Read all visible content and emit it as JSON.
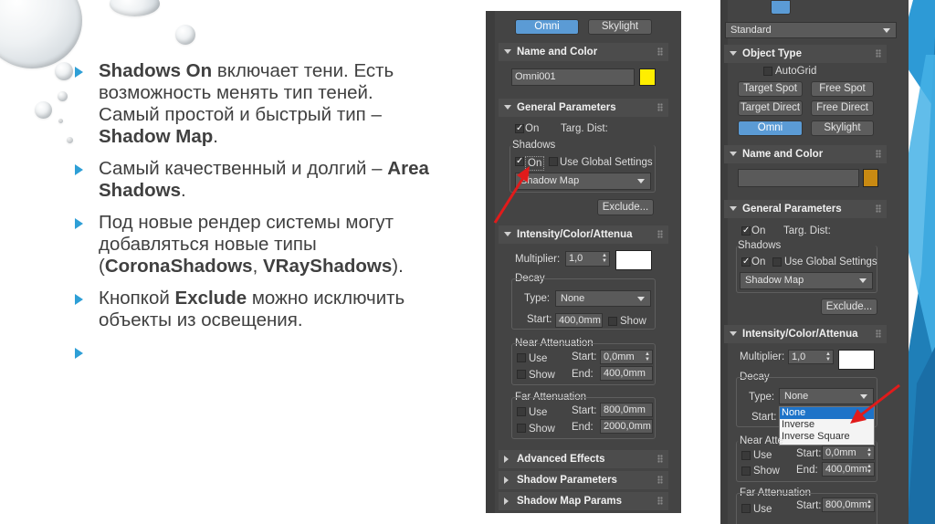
{
  "slide": {
    "bullets": [
      {
        "b": "Shadows On",
        "t": " включает тени. Есть возможность менять тип теней. Самый простой и быстрый тип – ",
        "b2": "Shadow Map",
        "t2": "."
      },
      {
        "t": "Самый качественный и долгий – ",
        "b": "Area Shadows",
        "t2": "."
      },
      {
        "t": "Под новые рендер системы могут добавляться новые типы (",
        "b": "CoronaShadows",
        "t2": ", ",
        "b2": "VRayShadows",
        "t3": ")."
      },
      {
        "t": "Кнопкой ",
        "b": "Exclude",
        "t2": " можно исключить объекты из освещения."
      }
    ]
  },
  "left_panel": {
    "top_buttons": [
      "Omni",
      "Skylight"
    ],
    "rollouts": {
      "name_color": "Name and Color",
      "general": "General Parameters",
      "intensity": "Intensity/Color/Attenua",
      "advanced": "Advanced Effects",
      "shadow_params": "Shadow Parameters",
      "shadow_map_params": "Shadow Map Params"
    },
    "object_name": "Omni001",
    "swatch_color": "#ffee00",
    "general": {
      "on": "On",
      "targ_dist": "Targ. Dist:",
      "shadows": "Shadows",
      "shadows_on": "On",
      "use_global": "Use Global Settings",
      "shadow_type": "Shadow Map",
      "exclude": "Exclude..."
    },
    "intensity": {
      "multiplier_label": "Multiplier:",
      "multiplier": "1,0",
      "decay": "Decay",
      "type_label": "Type:",
      "type": "None",
      "start_label": "Start:",
      "start": "400,0mm",
      "show": "Show"
    },
    "near": {
      "title": "Near Attenuation",
      "use": "Use",
      "show": "Show",
      "start_label": "Start:",
      "start": "0,0mm",
      "end_label": "End:",
      "end": "400,0mm"
    },
    "far": {
      "title": "Far Attenuation",
      "use": "Use",
      "show": "Show",
      "start_label": "Start:",
      "start": "800,0mm",
      "end_label": "End:",
      "end": "2000,0mm"
    }
  },
  "right_panel": {
    "category": "Standard",
    "rollouts": {
      "object_type": "Object Type",
      "name_color": "Name and Color",
      "general": "General Parameters",
      "intensity": "Intensity/Color/Attenua"
    },
    "autogrid": "AutoGrid",
    "object_buttons": [
      "Target Spot",
      "Free Spot",
      "Target Direct",
      "Free Direct",
      "Omni",
      "Skylight"
    ],
    "swatch_color": "#c98a12",
    "general": {
      "on": "On",
      "targ_dist": "Targ. Dist:",
      "shadows": "Shadows",
      "shadows_on": "On",
      "use_global": "Use Global Settings",
      "shadow_type": "Shadow Map",
      "exclude": "Exclude..."
    },
    "intensity": {
      "multiplier_label": "Multiplier:",
      "multiplier": "1,0",
      "decay": "Decay",
      "type_label": "Type:",
      "type": "None",
      "start_label": "Start:"
    },
    "decay_options": [
      "None",
      "Inverse",
      "Inverse Square"
    ],
    "near": {
      "title": "Near Atte",
      "use": "Use",
      "show": "Show",
      "start_label": "Start:",
      "start": "0,0mm",
      "end_label": "End:",
      "end": "400,0mm"
    },
    "far": {
      "title": "Far Attenuation",
      "use": "Use",
      "start_label": "Start:",
      "start": "800,0mm"
    }
  },
  "colors": {
    "arrow": "#e11b1b",
    "bullet": "#2e9fd6",
    "active": "#5b9bd5"
  }
}
